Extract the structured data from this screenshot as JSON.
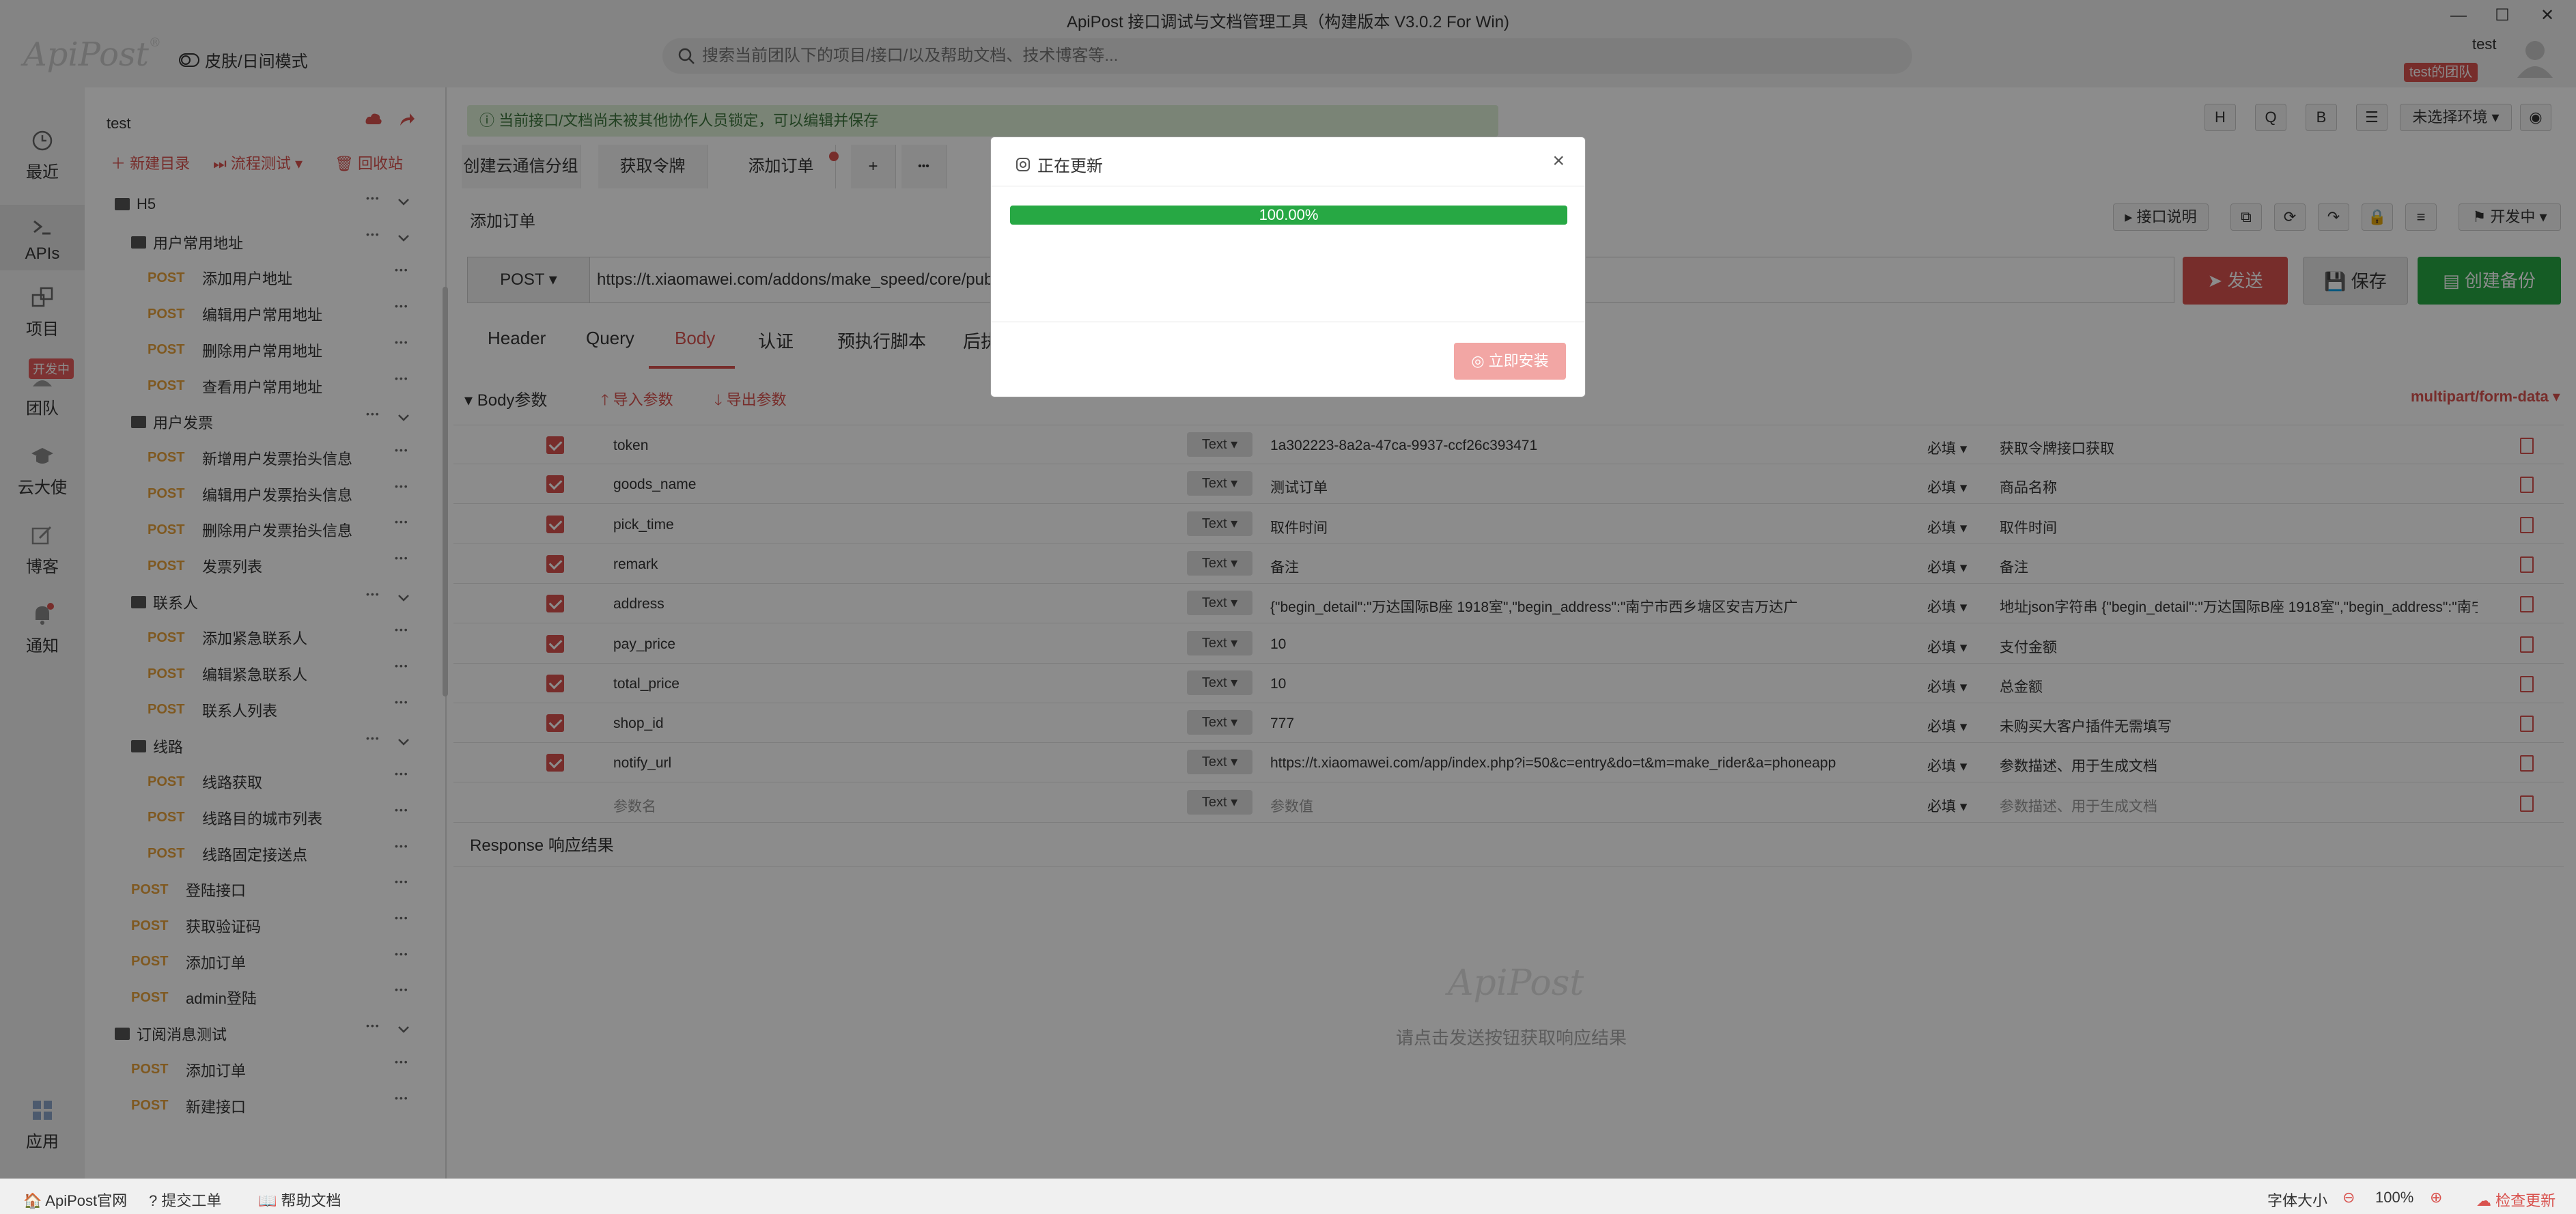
{
  "window": {
    "title": "ApiPost 接口调试与文档管理工具（构建版本 V3.0.2 For Win)",
    "min": "—",
    "max": "☐",
    "close": "✕"
  },
  "header": {
    "logo": "ApiPost",
    "logo_reg": "®",
    "skin_mode": "皮肤/日间模式",
    "search_placeholder": "搜索当前团队下的项目/接口/以及帮助文档、技术博客等...",
    "username": "test",
    "team_badge": "test的团队"
  },
  "rail": {
    "items": [
      {
        "label": "最近",
        "icon": "clock-icon"
      },
      {
        "label": "APIs",
        "icon": "terminal-icon"
      },
      {
        "label": "项目",
        "icon": "project-icon"
      },
      {
        "label": "团队",
        "icon": "team-icon"
      },
      {
        "label": "云大使",
        "icon": "cap-icon"
      },
      {
        "label": "博客",
        "icon": "edit-icon"
      },
      {
        "label": "通知",
        "icon": "bell-icon"
      },
      {
        "label": "应用",
        "icon": "apps-icon"
      }
    ],
    "dev_badge": "开发中"
  },
  "sidebar": {
    "project": "test",
    "new_dir": "新建目录",
    "flow_test": "流程测试",
    "recycle": "回收站",
    "method_label": "POST",
    "tree": [
      {
        "type": "folder",
        "label": "H5"
      },
      {
        "type": "folder",
        "label": "用户常用地址"
      },
      {
        "type": "api",
        "label": "添加用户地址"
      },
      {
        "type": "api",
        "label": "编辑用户常用地址"
      },
      {
        "type": "api",
        "label": "删除用户常用地址"
      },
      {
        "type": "api",
        "label": "查看用户常用地址"
      },
      {
        "type": "folder",
        "label": "用户发票"
      },
      {
        "type": "api",
        "label": "新增用户发票抬头信息"
      },
      {
        "type": "api",
        "label": "编辑用户发票抬头信息"
      },
      {
        "type": "api",
        "label": "删除用户发票抬头信息"
      },
      {
        "type": "api",
        "label": "发票列表"
      },
      {
        "type": "folder",
        "label": "联系人"
      },
      {
        "type": "api",
        "label": "添加紧急联系人"
      },
      {
        "type": "api",
        "label": "编辑紧急联系人"
      },
      {
        "type": "api",
        "label": "联系人列表"
      },
      {
        "type": "folder",
        "label": "线路"
      },
      {
        "type": "api",
        "label": "线路获取"
      },
      {
        "type": "api",
        "label": "线路目的城市列表"
      },
      {
        "type": "api",
        "label": "线路固定接送点"
      },
      {
        "type": "api",
        "label": "登陆接口"
      },
      {
        "type": "api",
        "label": "获取验证码"
      },
      {
        "type": "api",
        "label": "添加订单"
      },
      {
        "type": "api",
        "label": "admin登陆"
      },
      {
        "type": "folder",
        "label": "订阅消息测试"
      },
      {
        "type": "api",
        "label": "添加订单"
      },
      {
        "type": "api",
        "label": "新建接口"
      }
    ]
  },
  "main": {
    "lock_notice": "当前接口/文档尚未被其他协作人员锁定，可以编辑并保存",
    "tabs": [
      "创建云通信分组",
      "获取令牌",
      "添加订单"
    ],
    "tab_add": "+",
    "tab_more": "•••",
    "api_title": "添加订单",
    "api_desc_btn": "接口说明",
    "status_btn": "开发中",
    "env_select": "未选择环境",
    "tool_h": "H",
    "tool_q": "Q",
    "tool_b": "B",
    "method": "POST",
    "url": "https://t.xiaomawei.com/addons/make_speed/core/public/index.php/apis/order/add",
    "send": "发送",
    "save": "保存",
    "backup": "创建备份",
    "subtabs": [
      "Header",
      "Query",
      "Body",
      "认证",
      "预执行脚本",
      "后执行脚本"
    ],
    "body_params": "Body参数",
    "import": "导入参数",
    "export": "导出参数",
    "content_type": "multipart/form-data",
    "response_title": "Response 响应结果",
    "response_watermark": "ApiPost",
    "response_hint": "请点击发送按钮获取响应结果"
  },
  "params": [
    {
      "key": "token",
      "type": "Text",
      "value": "1a302223-8a2a-47ca-9937-ccf26c393471",
      "required": "必填",
      "desc": "获取令牌接口获取"
    },
    {
      "key": "goods_name",
      "type": "Text",
      "value": "测试订单",
      "required": "必填",
      "desc": "商品名称"
    },
    {
      "key": "pick_time",
      "type": "Text",
      "value": "取件时间",
      "required": "必填",
      "desc": "取件时间"
    },
    {
      "key": "remark",
      "type": "Text",
      "value": "备注",
      "required": "必填",
      "desc": "备注"
    },
    {
      "key": "address",
      "type": "Text",
      "value": "{\"begin_detail\":\"万达国际B座 1918室\",\"begin_address\":\"南宁市西乡塘区安吉万达广",
      "required": "必填",
      "desc": "地址json字符串 {\"begin_detail\":\"万达国际B座 1918室\",\"begin_address\":\"南宁市西"
    },
    {
      "key": "pay_price",
      "type": "Text",
      "value": "10",
      "required": "必填",
      "desc": "支付金额"
    },
    {
      "key": "total_price",
      "type": "Text",
      "value": "10",
      "required": "必填",
      "desc": "总金额"
    },
    {
      "key": "shop_id",
      "type": "Text",
      "value": "777",
      "required": "必填",
      "desc": "未购买大客户插件无需填写"
    },
    {
      "key": "notify_url",
      "type": "Text",
      "value": "https://t.xiaomawei.com/app/index.php?i=50&c=entry&do=t&m=make_rider&a=phoneapp",
      "required": "必填",
      "desc": "参数描述、用于生成文档"
    }
  ],
  "param_placeholder": {
    "key": "参数名",
    "type": "Text",
    "value": "参数值",
    "required": "必填",
    "desc": "参数描述、用于生成文档"
  },
  "modal": {
    "title": "正在更新",
    "progress": 100,
    "progress_text": "100.00%",
    "install": "立即安装",
    "close": "×"
  },
  "statusbar": {
    "site": "ApiPost官网",
    "ticket": "提交工单",
    "help": "帮助文档",
    "font_size": "字体大小",
    "zoom": "100%",
    "update": "检查更新"
  },
  "colors": {
    "accent": "#d9534f",
    "success": "#27a844",
    "post": "#e8a33d"
  }
}
